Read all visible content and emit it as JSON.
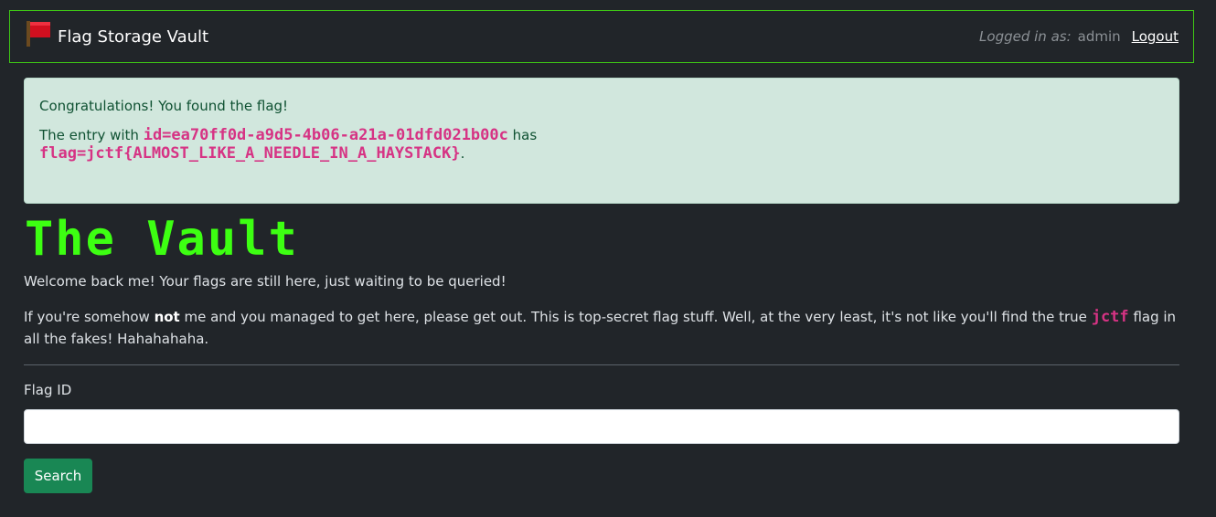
{
  "navbar": {
    "brand": "Flag Storage Vault",
    "logged_in_label": "Logged in as:",
    "username": "admin",
    "logout_label": "Logout"
  },
  "alert": {
    "line1": "Congratulations! You found the flag!",
    "entry_prefix": "The entry with",
    "entry_id": "id=ea70ff0d-a9d5-4b06-a21a-01dfd021b00c",
    "has_text": "has",
    "flag_value": "flag=jctf{ALMOST_LIKE_A_NEEDLE_IN_A_HAYSTACK}",
    "period": "."
  },
  "vault": {
    "title": "The Vault",
    "welcome": "Welcome back me! Your flags are still here, just waiting to be queried!",
    "warn_part1": "If you're somehow",
    "warn_bold": "not",
    "warn_part2": "me and you managed to get here, please get out. This is top-secret flag stuff. Well, at the very least, it's not like you'll find the true",
    "warn_code": "jctf",
    "warn_part3": "flag in all the fakes! Hahahahaha."
  },
  "form": {
    "field_label": "Flag ID",
    "field_value": "",
    "search_label": "Search"
  },
  "colors": {
    "accent_green": "#3dff12",
    "nav_border": "#3ec715",
    "code_pink": "#d63384",
    "alert_bg": "#d1e7dd",
    "button_green": "#198754"
  },
  "icons": {
    "brand": "red-flag-icon"
  }
}
